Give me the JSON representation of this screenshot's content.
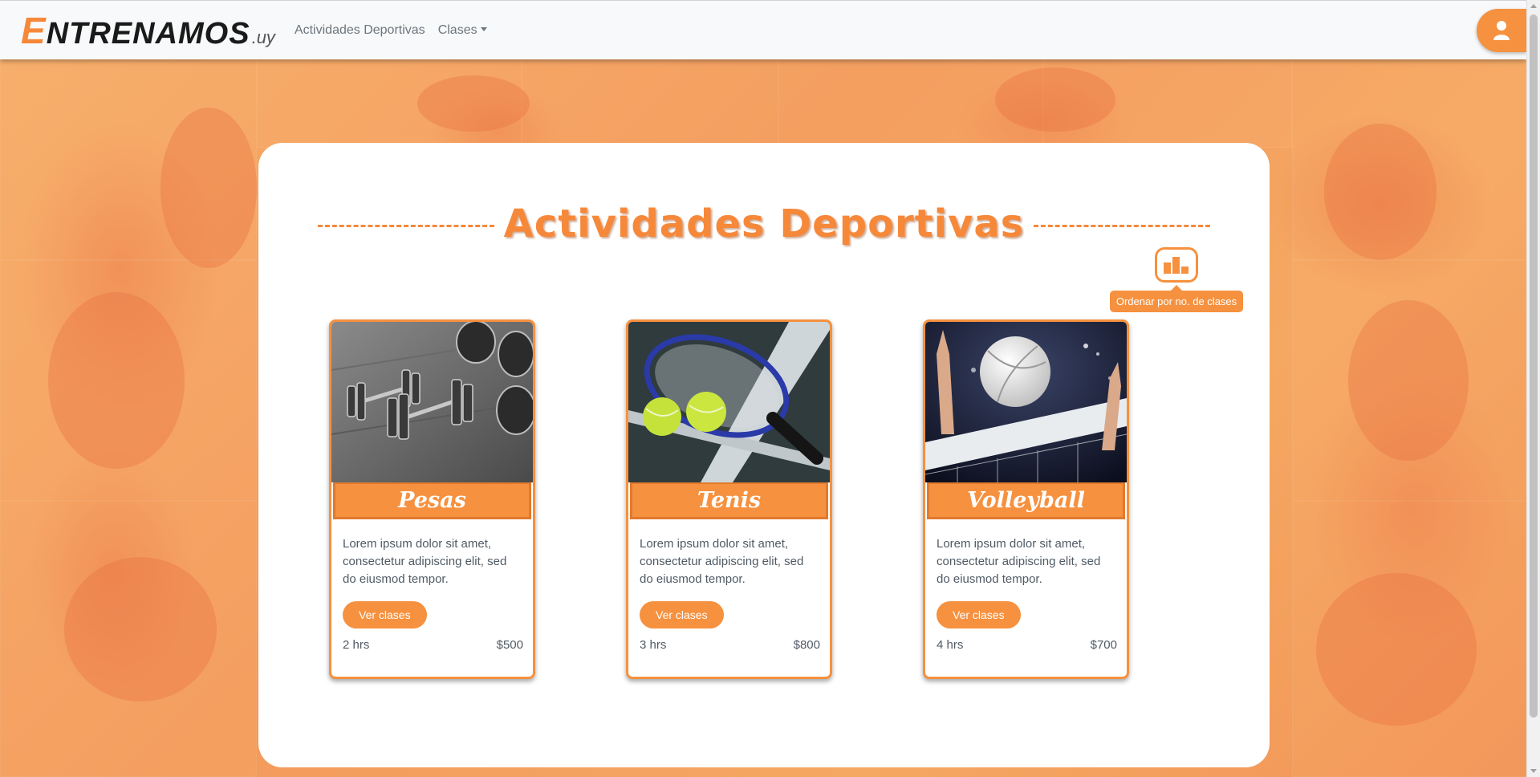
{
  "brand": {
    "first": "E",
    "rest": "NTRENAMOS",
    "tld": ".uy"
  },
  "nav": {
    "items": [
      {
        "label": "Actividades Deportivas"
      },
      {
        "label": "Clases"
      }
    ]
  },
  "main": {
    "title": "Actividades Deportivas",
    "sort_tooltip": "Ordenar por no. de clases"
  },
  "cards": [
    {
      "title": "Pesas",
      "text": "Lorem ipsum dolor sit amet, consectetur adipiscing elit, sed do eiusmod tempor.",
      "button": "Ver clases",
      "duration": "2 hrs",
      "price": "$500"
    },
    {
      "title": "Tenis",
      "text": "Lorem ipsum dolor sit amet, consectetur adipiscing elit, sed do eiusmod tempor.",
      "button": "Ver clases",
      "duration": "3 hrs",
      "price": "$800"
    },
    {
      "title": "Volleyball",
      "text": "Lorem ipsum dolor sit amet, consectetur adipiscing elit, sed do eiusmod tempor.",
      "button": "Ver clases",
      "duration": "4 hrs",
      "price": "$700"
    }
  ],
  "icons": {
    "user": "user-icon",
    "sort": "bar-chart-icon"
  },
  "colors": {
    "accent": "#f6913f",
    "brand_orange": "#f6883a",
    "background": "#f5a25e"
  }
}
